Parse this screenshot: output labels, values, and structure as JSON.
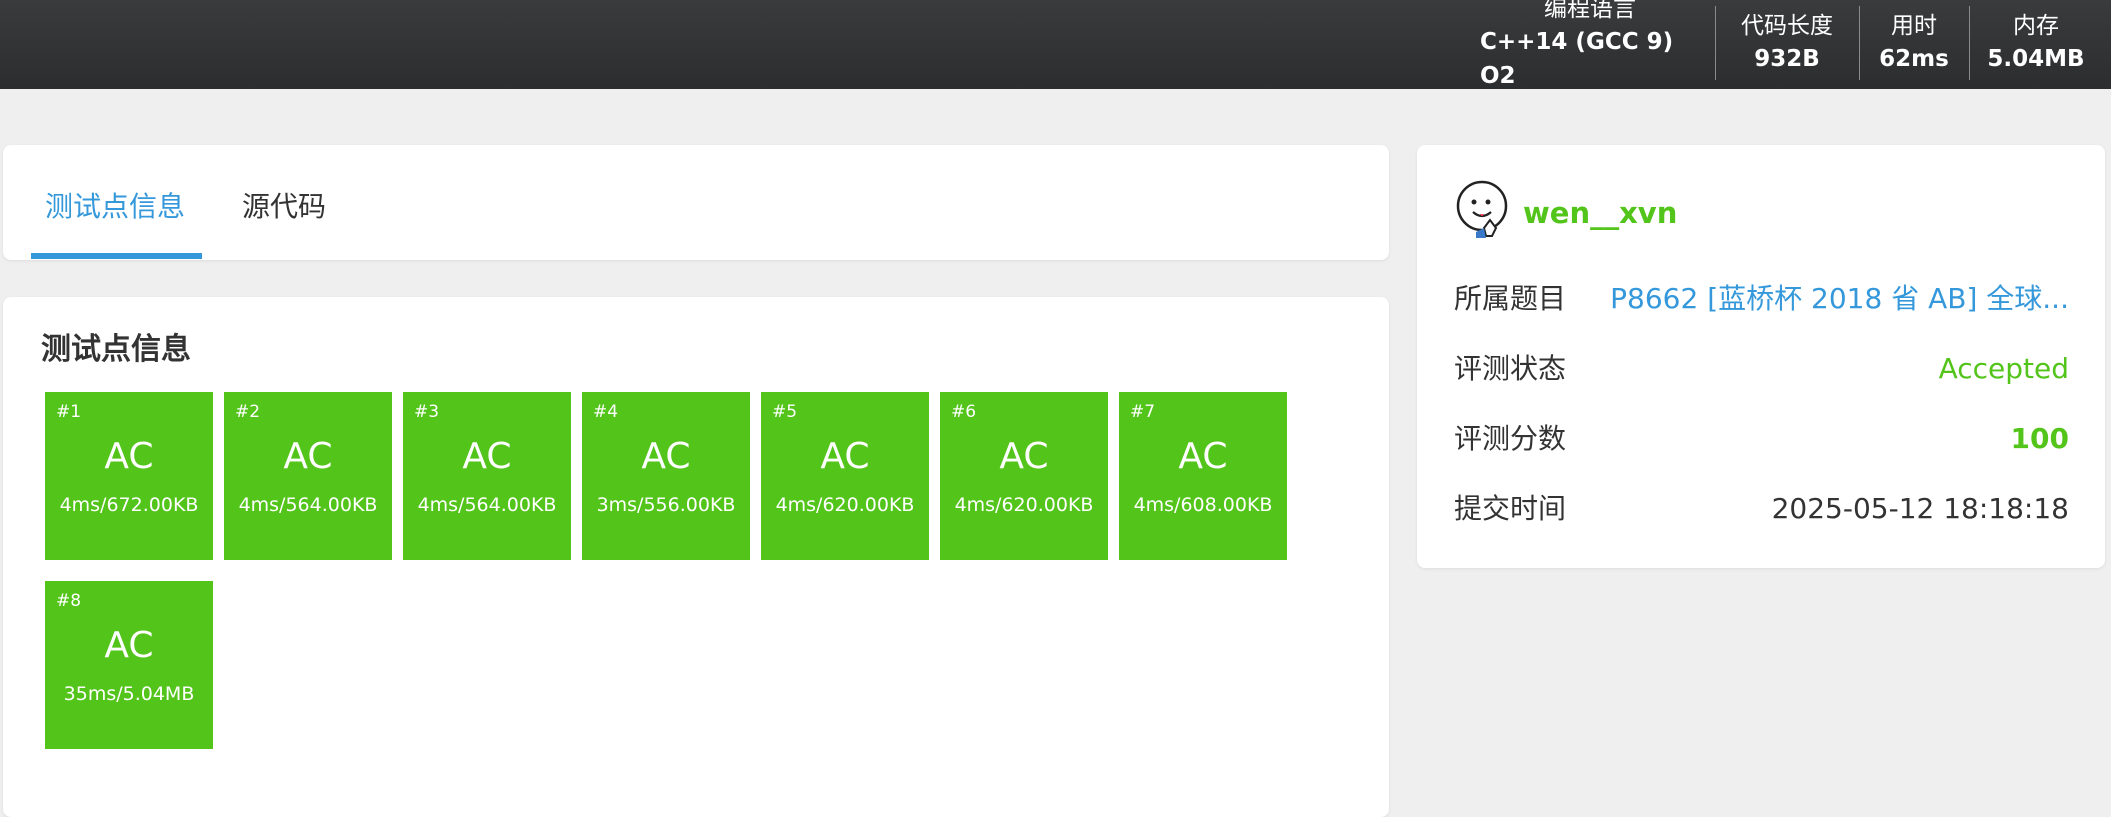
{
  "header": {
    "stats": [
      {
        "label": "编程语言",
        "value": "C++14 (GCC 9) O2"
      },
      {
        "label": "代码长度",
        "value": "932B"
      },
      {
        "label": "用时",
        "value": "62ms"
      },
      {
        "label": "内存",
        "value": "5.04MB"
      }
    ]
  },
  "tabs": [
    {
      "label": "测试点信息",
      "active": true
    },
    {
      "label": "源代码",
      "active": false
    }
  ],
  "tests": {
    "title": "测试点信息",
    "cases": [
      {
        "num": "#1",
        "status": "AC",
        "result": "4ms/672.00KB"
      },
      {
        "num": "#2",
        "status": "AC",
        "result": "4ms/564.00KB"
      },
      {
        "num": "#3",
        "status": "AC",
        "result": "4ms/564.00KB"
      },
      {
        "num": "#4",
        "status": "AC",
        "result": "3ms/556.00KB"
      },
      {
        "num": "#5",
        "status": "AC",
        "result": "4ms/620.00KB"
      },
      {
        "num": "#6",
        "status": "AC",
        "result": "4ms/620.00KB"
      },
      {
        "num": "#7",
        "status": "AC",
        "result": "4ms/608.00KB"
      },
      {
        "num": "#8",
        "status": "AC",
        "result": "35ms/5.04MB"
      }
    ]
  },
  "submission": {
    "username": "wen__xvn",
    "avatar_icon": "smiley-avatar-icon",
    "rows": [
      {
        "label": "所属题目",
        "value": "P8662 [蓝桥杯 2018 省 AB] 全球..."
      },
      {
        "label": "评测状态",
        "value": "Accepted"
      },
      {
        "label": "评测分数",
        "value": "100"
      },
      {
        "label": "提交时间",
        "value": "2025-05-12 18:18:18"
      }
    ]
  },
  "colors": {
    "accent": "#3498db",
    "ac_green": "#52c41a",
    "header_bg": "#2f3032"
  }
}
